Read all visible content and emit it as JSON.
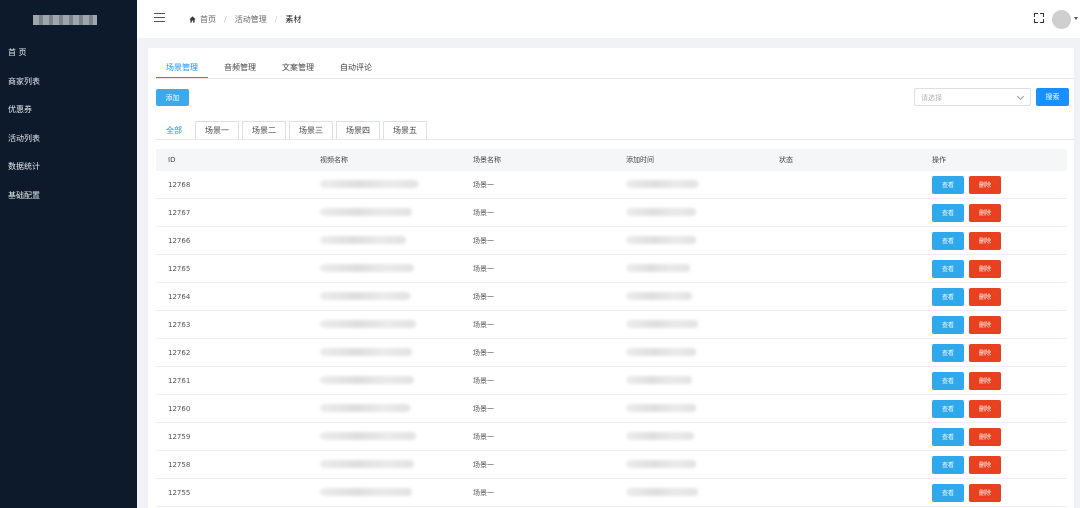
{
  "sidebar": {
    "items": [
      {
        "label": "首 页"
      },
      {
        "label": "商家列表"
      },
      {
        "label": "优惠券"
      },
      {
        "label": "活动列表"
      },
      {
        "label": "数据统计"
      },
      {
        "label": "基础配置"
      }
    ]
  },
  "header": {
    "breadcrumb": [
      "首页",
      "活动管理",
      "素材"
    ],
    "menu_icon": "hamburger-icon",
    "fullscreen_icon": "fullscreen-icon"
  },
  "tabs": [
    {
      "label": "场景管理",
      "active": true
    },
    {
      "label": "音频管理",
      "active": false
    },
    {
      "label": "文案管理",
      "active": false
    },
    {
      "label": "自动评论",
      "active": false
    }
  ],
  "toolbar": {
    "add_label": "添加",
    "select_placeholder": "请选择",
    "search_label": "搜索"
  },
  "scene_tabs": [
    {
      "label": "全部",
      "active": true
    },
    {
      "label": "场景一",
      "active": false
    },
    {
      "label": "场景二",
      "active": false
    },
    {
      "label": "场景三",
      "active": false
    },
    {
      "label": "场景四",
      "active": false
    },
    {
      "label": "场景五",
      "active": false
    }
  ],
  "table": {
    "columns": [
      "ID",
      "视频名称",
      "场景名称",
      "添加时间",
      "状态",
      "操作"
    ],
    "view_label": "查看",
    "delete_label": "删除",
    "rows": [
      {
        "id": "12768",
        "scene": "场景一",
        "enabled": true
      },
      {
        "id": "12767",
        "scene": "场景一",
        "enabled": true
      },
      {
        "id": "12766",
        "scene": "场景一",
        "enabled": true
      },
      {
        "id": "12765",
        "scene": "场景一",
        "enabled": true
      },
      {
        "id": "12764",
        "scene": "场景一",
        "enabled": true
      },
      {
        "id": "12763",
        "scene": "场景一",
        "enabled": true
      },
      {
        "id": "12762",
        "scene": "场景一",
        "enabled": true
      },
      {
        "id": "12761",
        "scene": "场景一",
        "enabled": true
      },
      {
        "id": "12760",
        "scene": "场景一",
        "enabled": true
      },
      {
        "id": "12759",
        "scene": "场景一",
        "enabled": true
      },
      {
        "id": "12758",
        "scene": "场景一",
        "enabled": true
      },
      {
        "id": "12755",
        "scene": "场景一",
        "enabled": true
      }
    ]
  },
  "colors": {
    "sidebar_bg": "#0c1a2b",
    "primary": "#1890ff",
    "view_button": "#2fa8ec",
    "delete_button": "#e8411f",
    "toggle_on": "#2f7cf6"
  }
}
